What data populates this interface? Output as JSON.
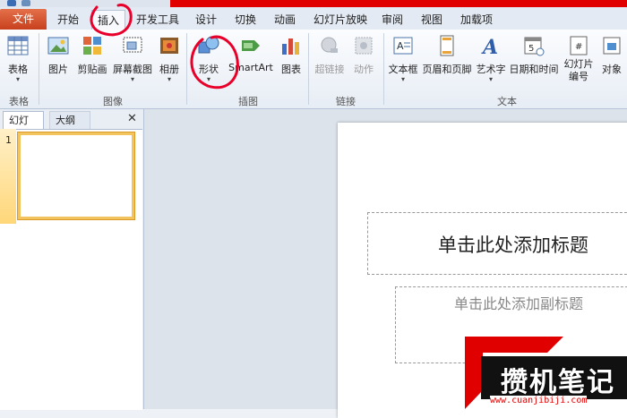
{
  "ribbon_tabs": [
    {
      "label": "文件"
    },
    {
      "label": "开始"
    },
    {
      "label": "插入"
    },
    {
      "label": "开发工具"
    },
    {
      "label": "设计"
    },
    {
      "label": "切换"
    },
    {
      "label": "动画"
    },
    {
      "label": "幻灯片放映"
    },
    {
      "label": "审阅"
    },
    {
      "label": "视图"
    },
    {
      "label": "加载项"
    }
  ],
  "active_tab": "插入",
  "groups": {
    "table": {
      "label": "表格",
      "buttons": [
        "表格"
      ]
    },
    "images": {
      "label": "图像",
      "buttons": [
        "图片",
        "剪贴画",
        "屏幕截图",
        "相册"
      ]
    },
    "illustrations": {
      "label": "插图",
      "buttons": [
        "形状",
        "SmartArt",
        "图表"
      ]
    },
    "links": {
      "label": "链接",
      "buttons": [
        "超链接",
        "动作"
      ]
    },
    "text": {
      "label": "文本",
      "buttons": [
        "文本框",
        "页眉和页脚",
        "艺术字",
        "日期和时间",
        "幻灯片编号",
        "对象"
      ]
    }
  },
  "slide_panel": {
    "tab_slides": "幻灯片",
    "tab_outline": "大纲",
    "close_glyph": "✕",
    "slide_number": "1"
  },
  "slide": {
    "title_placeholder": "单击此处添加标题",
    "subtitle_placeholder": "单击此处添加副标题"
  },
  "watermark": {
    "text": "攒机笔记",
    "url": "www.cuanjibiji.com"
  },
  "colors": {
    "file_tab": "#d3532c",
    "annotation": "#e8002a",
    "selected_thumb_border": "#f3c45e"
  }
}
